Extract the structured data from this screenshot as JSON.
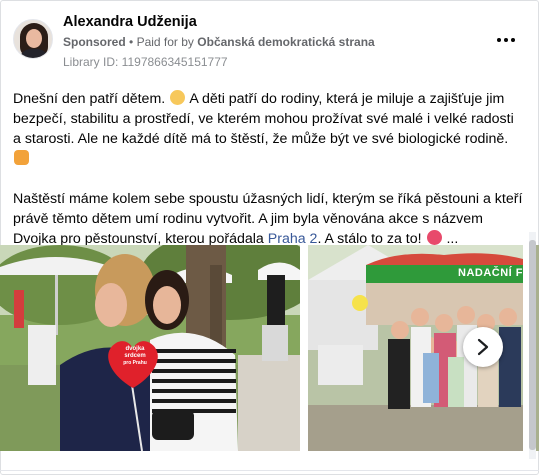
{
  "header": {
    "author": "Alexandra Udženija",
    "sponsored_label": "Sponsored",
    "separator": "•",
    "paid_for_prefix": "Paid for by",
    "advertiser": "Občanská demokratická strana",
    "library_id": "Library ID: 1197866345151777",
    "more_icon": "more-horizontal-icon"
  },
  "post": {
    "p1_a": "Dnešní den patří dětem.",
    "p1_b": "A děti patří do rodiny, která je miluje a zajišťuje jim bezpečí, stabilitu a prostředí, ve kterém mohou prožívat své malé i velké radosti a starosti. Ale ne každé dítě má to štěstí, že může být ve své biologické rodině.",
    "p2_a": "Naštěstí máme kolem sebe spoustu úžasných lidí, kterým se říká pěstouni a kteří právě těmto dětem umí rodinu vytvořit. A jim byla věnována akce s názvem Dvojka pro pěstounství, kterou pořádala",
    "p2_link": "Praha 2",
    "p2_b": ". A stálo to za to!",
    "ellipsis": "..."
  },
  "carousel": {
    "image1": {
      "balloon_line1": "dvojka",
      "balloon_line2": "srdcem",
      "balloon_line3": "pro Prahu"
    },
    "image2": {
      "banner_text": "NADAČNÍ FOND"
    },
    "next_icon": "chevron-right-icon"
  },
  "colors": {
    "link": "#385898",
    "secondary_text": "#65676b",
    "balloon": "#e0212b",
    "banner_green": "#2f9a3a"
  }
}
